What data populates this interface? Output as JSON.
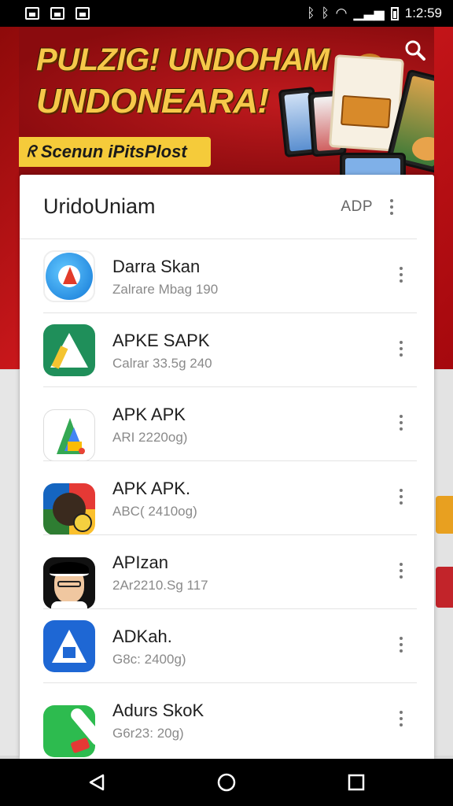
{
  "status_bar": {
    "time": "1:2:59",
    "bluetooth_icon": "bluetooth-icon",
    "wifi_icon": "wifi-icon",
    "signal_icon": "signal-icon",
    "battery_icon": "battery-icon"
  },
  "banner": {
    "title_line1": "PULZIG! UNDOHAM",
    "title_line2": "UNDONEARA!",
    "badge_label": "Scenun iPitsPlost",
    "badge_icon": "person-icon",
    "search_icon": "search-icon",
    "accent_color": "#f6c84a",
    "background_color": "#b0141a"
  },
  "card": {
    "title": "UridoUniam",
    "action_label": "ADP",
    "apps": [
      {
        "name": "Darra Skan",
        "meta": "Zalrare Mbag 190",
        "icon": "blue-circle-app-icon"
      },
      {
        "name": "APKE SAPK",
        "meta": "Calrar 33.5g 240",
        "icon": "green-a-app-icon"
      },
      {
        "name": "APK APK",
        "meta": "ARI 2220og)",
        "icon": "play-triangle-app-icon"
      },
      {
        "name": "APK APK.",
        "meta": "ABC( 2410og)",
        "icon": "colorful-badge-app-icon"
      },
      {
        "name": "APIzan",
        "meta": "2Ar2210.Sg 117",
        "icon": "avatar-face-app-icon"
      },
      {
        "name": "ADKah.",
        "meta": "G8c: 2400g)",
        "icon": "blue-a-app-icon"
      },
      {
        "name": "Adurs SkoK",
        "meta": "G6r23: 20g)",
        "icon": "green-slash-app-icon"
      }
    ]
  },
  "nav_bar": {
    "back_icon": "back-icon",
    "home_icon": "home-icon",
    "recents_icon": "recents-icon"
  }
}
